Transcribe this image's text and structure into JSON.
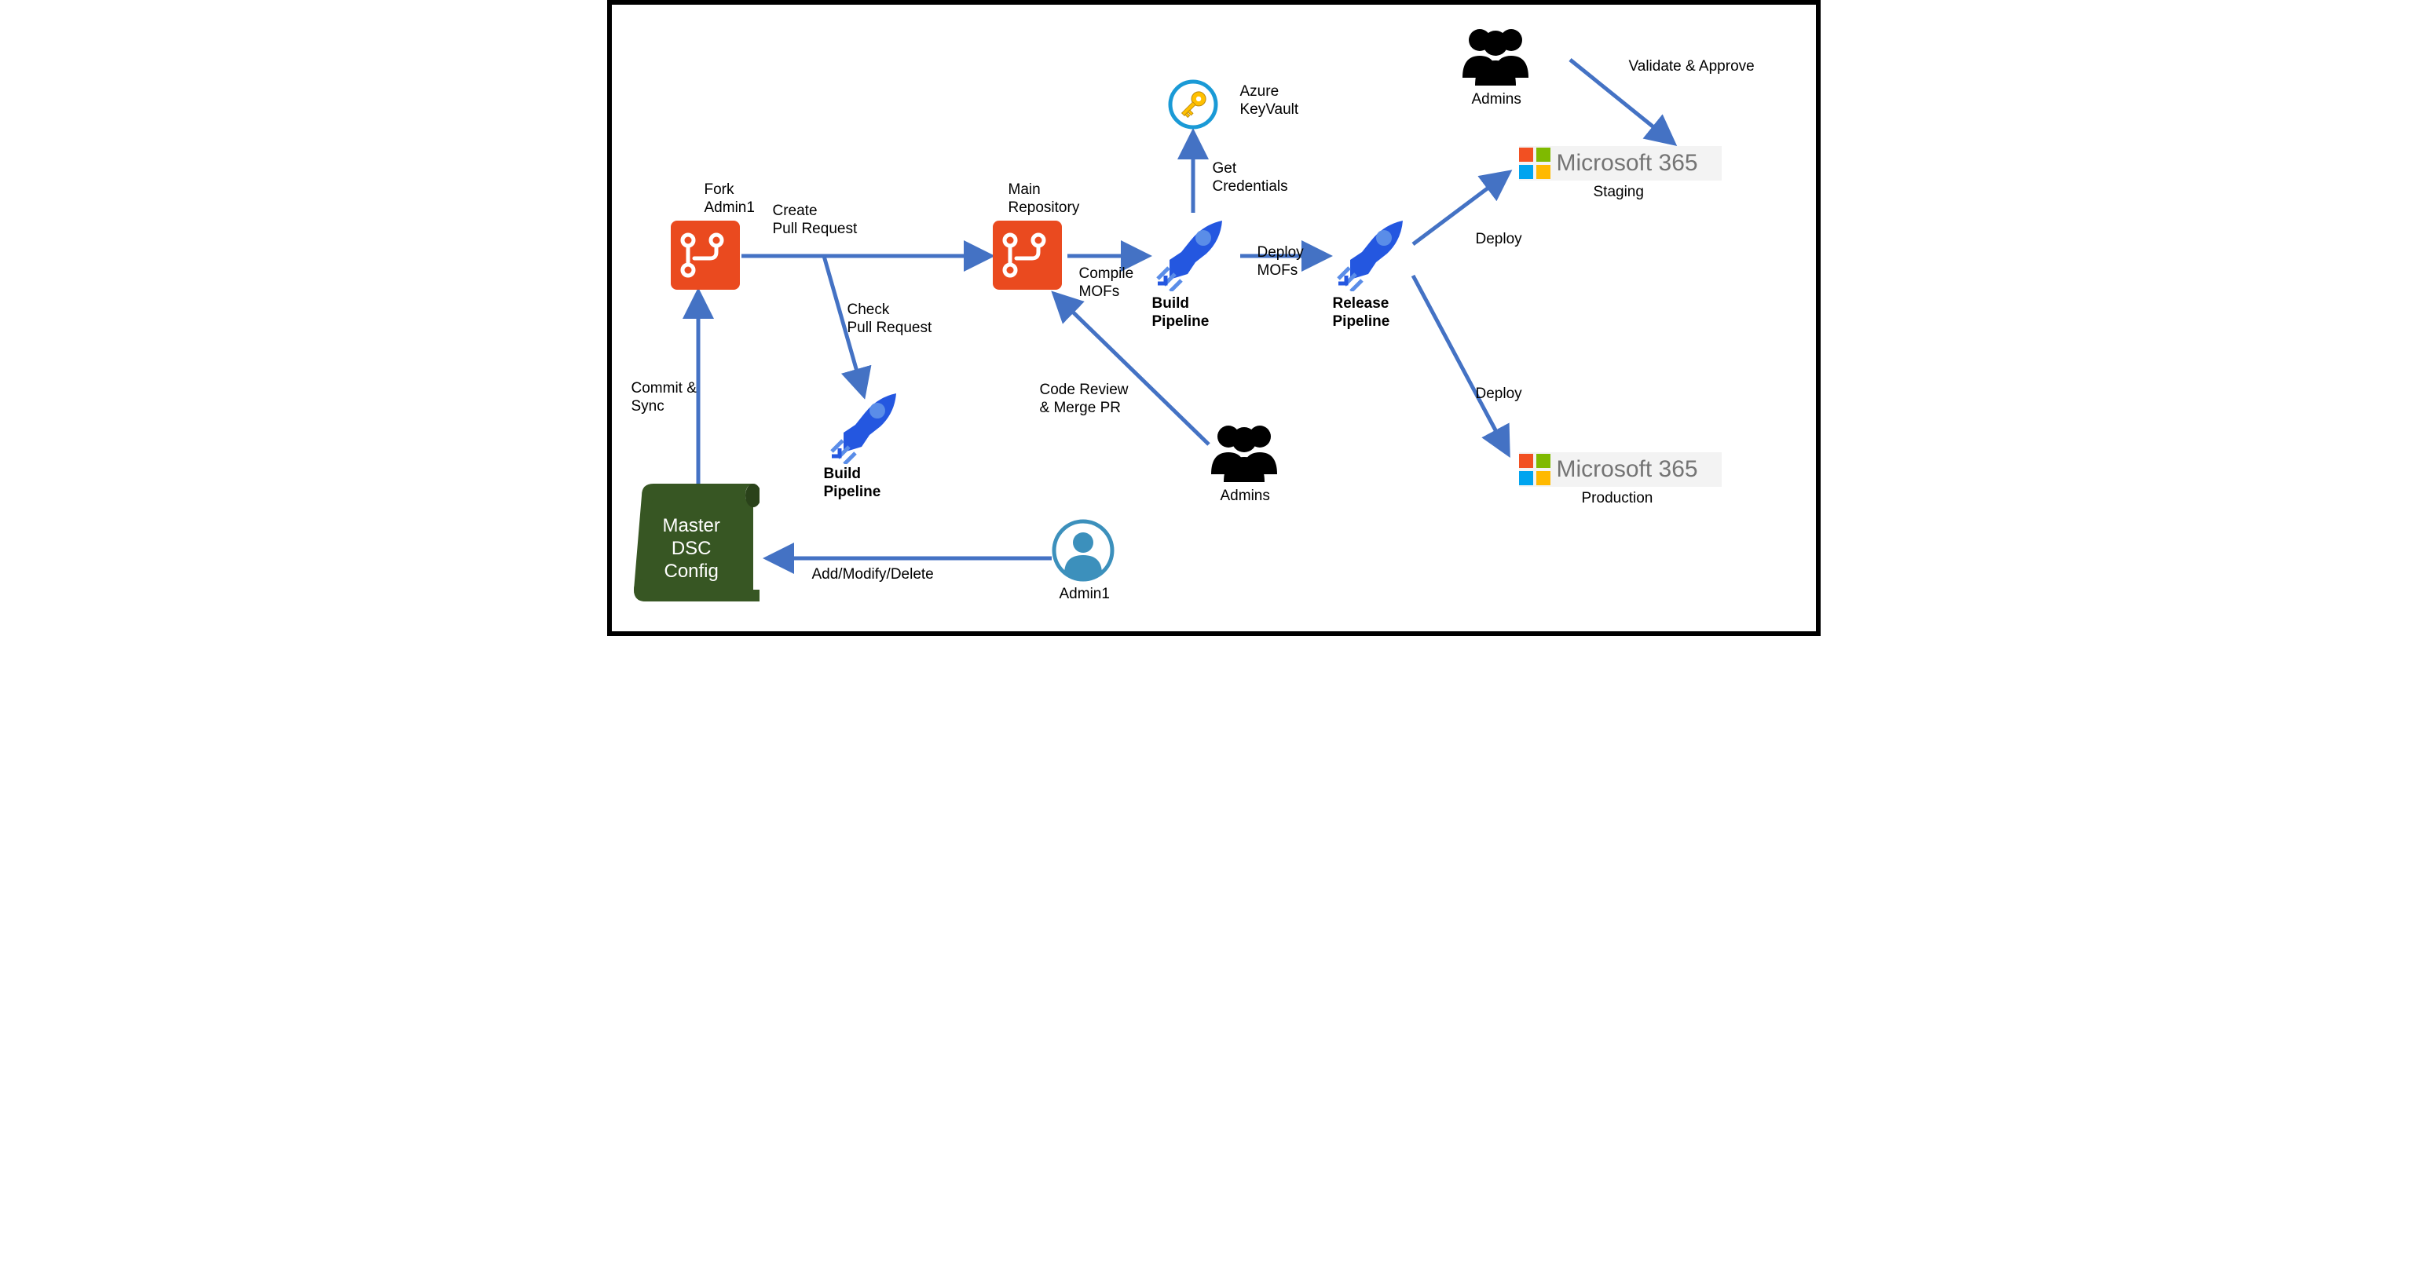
{
  "nodes": {
    "fork_repo": "Fork\nAdmin1",
    "main_repo": "Main\nRepository",
    "build_pipeline_check": "Build\nPipeline",
    "build_pipeline_main": "Build\nPipeline",
    "release_pipeline": "Release\nPipeline",
    "keyvault": "Azure\nKeyVault",
    "admins_review": "Admins",
    "admins_approve": "Admins",
    "admin1": "Admin1",
    "dsc": "Master\nDSC\nConfig",
    "ms365_staging_env": "Staging",
    "ms365_prod_env": "Production",
    "ms365_brand": "Microsoft 365"
  },
  "edges": {
    "commit_sync": "Commit &\nSync",
    "create_pr": "Create\nPull Request",
    "check_pr": "Check\nPull Request",
    "add_modify": "Add/Modify/Delete",
    "code_review": "Code Review\n& Merge PR",
    "compile": "Compile\nMOFs",
    "get_creds": "Get\nCredentials",
    "deploy_mofs": "Deploy\nMOFs",
    "deploy_staging": "Deploy",
    "deploy_prod": "Deploy",
    "validate_approve": "Validate & Approve"
  },
  "colors": {
    "arrow": "#4472c4",
    "repo": "#ea4a1f",
    "rocket": "#2457e0",
    "rocket_mid": "#5a8de8",
    "scroll": "#375623",
    "admin_blue": "#3c90bc",
    "key": "#ffc000"
  }
}
